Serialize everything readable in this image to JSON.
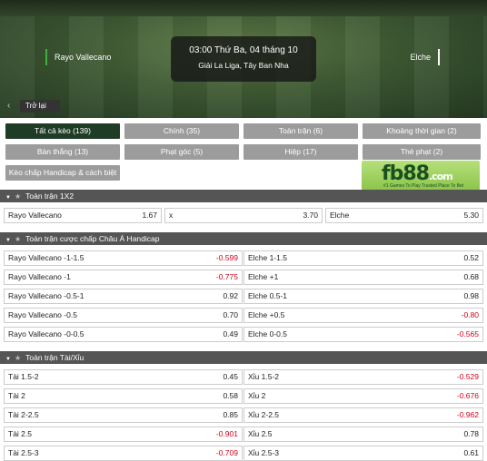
{
  "header": {
    "home_team": "Rayo Vallecano",
    "away_team": "Elche",
    "time": "03:00 Thứ Ba, 04 tháng 10",
    "league": "Giải La Liga, Tây Ban Nha",
    "back_label": "Trở lại"
  },
  "tabs": [
    {
      "label": "Tất cả kèo (139)",
      "active": true
    },
    {
      "label": "Chính (35)",
      "active": false
    },
    {
      "label": "Toàn trận (6)",
      "active": false
    },
    {
      "label": "Khoảng thời gian (2)",
      "active": false
    },
    {
      "label": "Bàn thắng (13)",
      "active": false
    },
    {
      "label": "Phạt góc (5)",
      "active": false
    },
    {
      "label": "Hiệp (17)",
      "active": false
    },
    {
      "label": "Thẻ phạt (2)",
      "active": false
    },
    {
      "label": "Kèo chấp Handicap & cách biệt (5)",
      "active": false
    }
  ],
  "ad": {
    "brand": "fb88",
    "suffix": ".com",
    "tagline": "#1 Games To Play  Trusted Place To Bet"
  },
  "sections": [
    {
      "title": "Toàn trận 1X2",
      "rows": [
        [
          {
            "label": "Rayo Vallecano",
            "value": "1.67"
          },
          {
            "label": "x",
            "value": "3.70"
          },
          {
            "label": "Elche",
            "value": "5.30"
          }
        ]
      ]
    },
    {
      "title": "Toàn trận cược chấp Châu Á Handicap",
      "rows": [
        [
          {
            "label": "Rayo Vallecano -1-1.5",
            "value": "-0.599"
          },
          {
            "label": "Elche 1-1.5",
            "value": "0.52"
          }
        ],
        [
          {
            "label": "Rayo Vallecano -1",
            "value": "-0.775"
          },
          {
            "label": "Elche +1",
            "value": "0.68"
          }
        ],
        [
          {
            "label": "Rayo Vallecano -0.5-1",
            "value": "0.92"
          },
          {
            "label": "Elche 0.5-1",
            "value": "0.98"
          }
        ],
        [
          {
            "label": "Rayo Vallecano -0.5",
            "value": "0.70"
          },
          {
            "label": "Elche +0.5",
            "value": "-0.80"
          }
        ],
        [
          {
            "label": "Rayo Vallecano -0-0.5",
            "value": "0.49"
          },
          {
            "label": "Elche 0-0.5",
            "value": "-0.565"
          }
        ]
      ]
    },
    {
      "title": "Toàn trận Tài/Xỉu",
      "rows": [
        [
          {
            "label": "Tài 1.5-2",
            "value": "0.45"
          },
          {
            "label": "Xỉu 1.5-2",
            "value": "-0.529"
          }
        ],
        [
          {
            "label": "Tài 2",
            "value": "0.58"
          },
          {
            "label": "Xỉu 2",
            "value": "-0.676"
          }
        ],
        [
          {
            "label": "Tài 2-2.5",
            "value": "0.85"
          },
          {
            "label": "Xỉu 2-2.5",
            "value": "-0.962"
          }
        ],
        [
          {
            "label": "Tài 2.5",
            "value": "-0.901"
          },
          {
            "label": "Xỉu 2.5",
            "value": "0.78"
          }
        ],
        [
          {
            "label": "Tài 2.5-3",
            "value": "-0.709"
          },
          {
            "label": "Xỉu 2.5-3",
            "value": "0.61"
          }
        ]
      ]
    }
  ],
  "colors": {
    "active_tab": "#1f3d26",
    "tab": "#9c9c9c",
    "section_header": "#555555",
    "negative": "#d0021b"
  }
}
